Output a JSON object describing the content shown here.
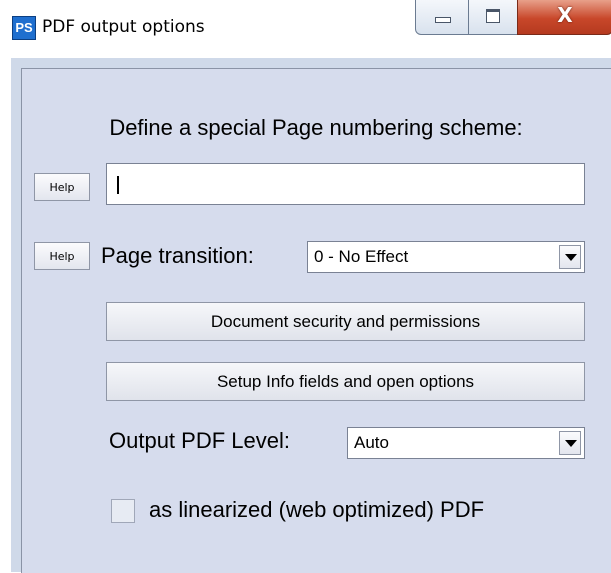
{
  "window": {
    "title": "PDF output options",
    "icon_text": "PS",
    "icon": "ps-app-icon",
    "controls": {
      "minimize": "minimize-icon",
      "maximize": "maximize-icon",
      "close_glyph": "X"
    }
  },
  "page_numbering": {
    "heading": "Define a special Page numbering scheme:",
    "help_label": "Help",
    "value": ""
  },
  "page_transition": {
    "help_label": "Help",
    "label": "Page transition:",
    "selected": "0 - No Effect"
  },
  "buttons": {
    "security": "Document security and permissions",
    "info": "Setup Info fields and open options"
  },
  "output_level": {
    "label": "Output PDF Level:",
    "selected": "Auto"
  },
  "linearized": {
    "label": "as linearized (web optimized) PDF",
    "checked": false
  },
  "colors": {
    "panel_bg": "#d6dced",
    "close_red": "#c8472a",
    "icon_blue": "#1f6fcf"
  }
}
